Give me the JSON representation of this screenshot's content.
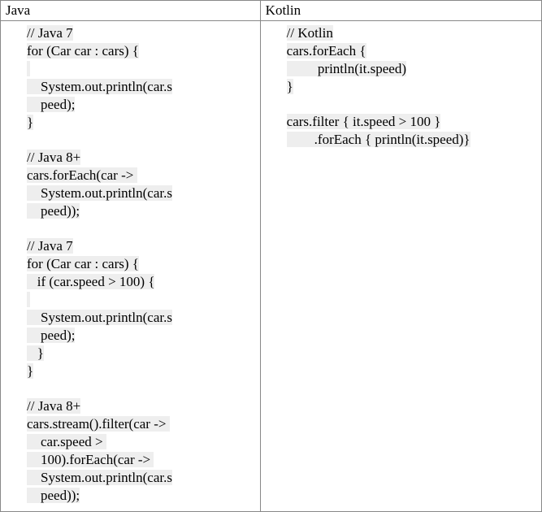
{
  "headers": {
    "left": "Java",
    "right": "Kotlin"
  },
  "java": {
    "l1": "// Java 7",
    "l2a": "for (Car car : cars) {",
    "l2b": " ",
    "l3a": "    System.out.println(car.s",
    "l3b": "    peed);",
    "l4": "}",
    "l5": "// Java 8+",
    "l6a": "cars.forEach(car -> ",
    "l6b": "    System.out.println(car.s",
    "l6c": "    peed));",
    "l7": "// Java 7",
    "l8": "for (Car car : cars) {",
    "l9": "   if (car.speed > 100) {",
    "l9b": " ",
    "l10a": "    System.out.println(car.s",
    "l10b": "    peed);",
    "l11": "   }",
    "l12": "}",
    "l13": "// Java 8+",
    "l14a": "cars.stream().filter(car -> ",
    "l14b": "    car.speed > ",
    "l14c": "    100).forEach(car -> ",
    "l14d": "    System.out.println(car.s",
    "l14e": "    peed));"
  },
  "kotlin": {
    "l1": "// Kotlin",
    "l2": "cars.forEach {",
    "l3": "         println(it.speed)",
    "l4": "}",
    "l5": "cars.filter { it.speed > 100 }",
    "l6": "        .forEach { println(it.speed)}"
  },
  "chart_data": {
    "type": "table",
    "title": "Java vs Kotlin code comparison",
    "columns": [
      "Java",
      "Kotlin"
    ],
    "rows": [
      {
        "Java": "// Java 7\nfor (Car car : cars) {\n    System.out.println(car.speed);\n}\n\n// Java 8+\ncars.forEach(car -> System.out.println(car.speed));\n\n// Java 7\nfor (Car car : cars) {\n   if (car.speed > 100) {\n    System.out.println(car.speed);\n   }\n}\n\n// Java 8+\ncars.stream().filter(car -> car.speed > 100).forEach(car -> System.out.println(car.speed));",
        "Kotlin": "// Kotlin\ncars.forEach {\n         println(it.speed)\n}\n\ncars.filter { it.speed > 100 }\n        .forEach { println(it.speed)}"
      }
    ]
  }
}
